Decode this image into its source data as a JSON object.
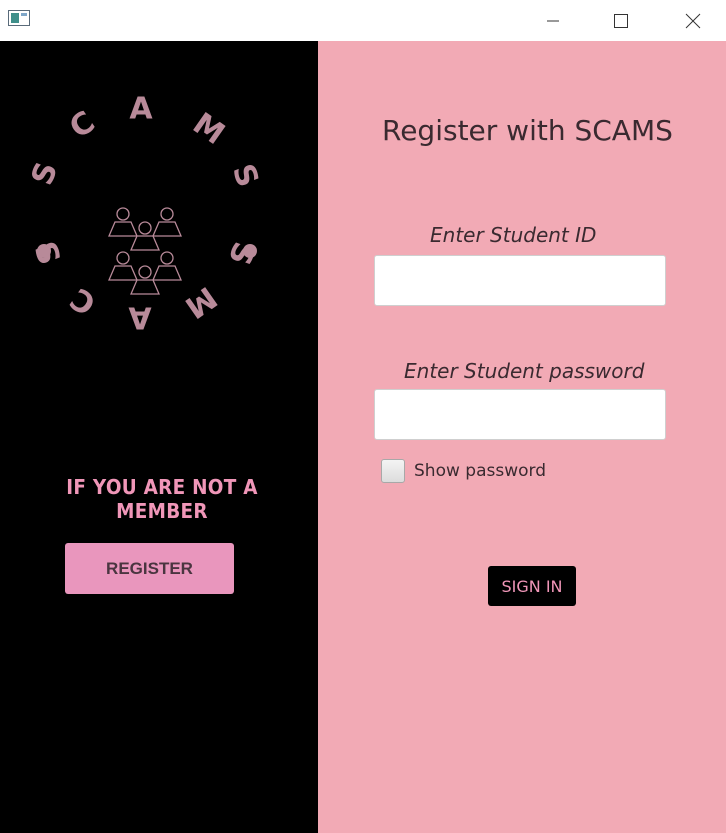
{
  "window": {
    "icon": "app-window-icon",
    "controls": [
      "minimize-icon",
      "maximize-icon",
      "close-icon"
    ]
  },
  "left_panel": {
    "logo_text": "SCAMS",
    "logo_ring": [
      "S",
      "C",
      "A",
      "M",
      "S",
      "S",
      "M",
      "A",
      "C",
      "S"
    ],
    "logo_icon": "people-group-icon",
    "member_prompt": "IF YOU ARE NOT A MEMBER",
    "register_label": "REGISTER"
  },
  "right_panel": {
    "heading": "Register with SCAMS",
    "student_id_label": "Enter Student ID",
    "student_id_value": "",
    "password_label": "Enter Student password",
    "password_value": "",
    "show_password_label": "Show password",
    "show_password_checked": false,
    "signin_label": "SIGN IN"
  },
  "colors": {
    "left_bg": "#000000",
    "right_bg": "#f2aab5",
    "accent_pink": "#f096b8",
    "button_pink": "#e996bd",
    "logo_mauve": "#b88a99"
  }
}
